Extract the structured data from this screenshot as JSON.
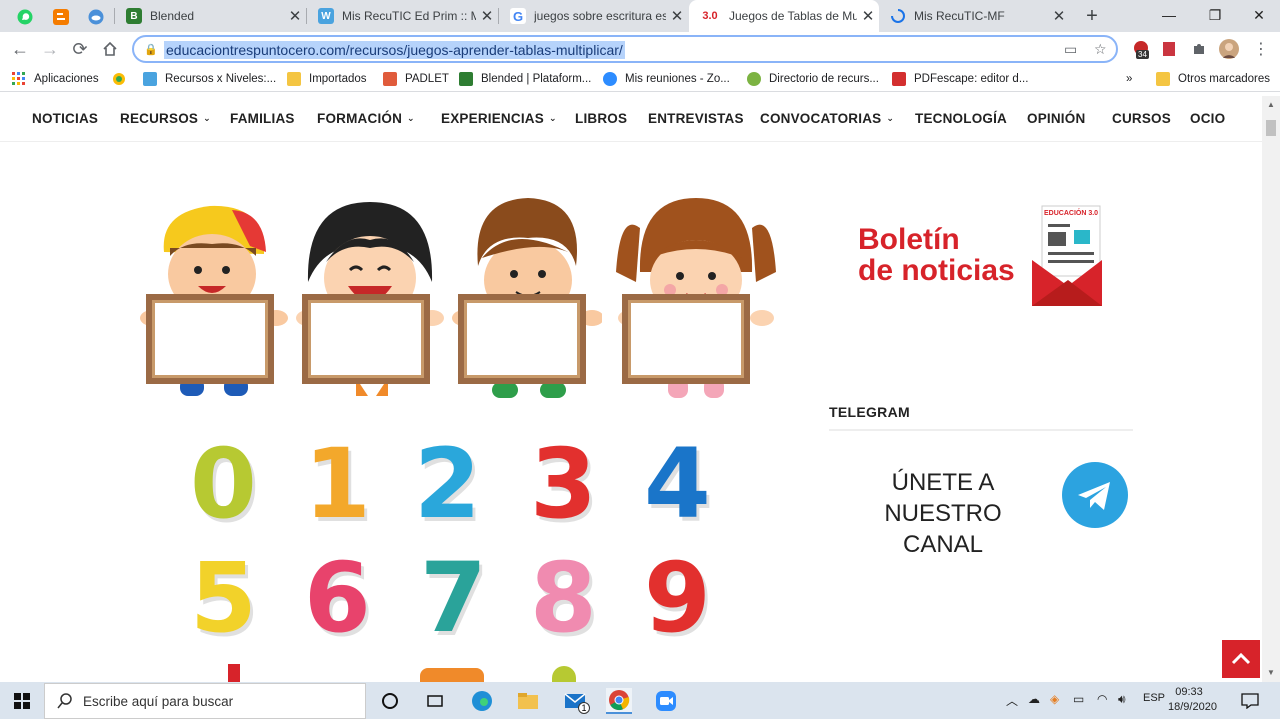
{
  "tabs": [
    {
      "title": "Blended",
      "fav_text": "B",
      "fav_color": "#2e7d32"
    },
    {
      "title": "Mis RecuTIC Ed Prim :: Mis",
      "fav_text": "W",
      "fav_color": "#4aa3df"
    },
    {
      "title": "juegos sobre escritura esp",
      "fav_text": "G",
      "fav_color": "#4285f4"
    },
    {
      "title": "Juegos de Tablas de Multip",
      "fav_text": "3.0",
      "fav_color": "#d7232a"
    },
    {
      "title": "Mis RecuTIC-MF",
      "fav_text": "",
      "fav_color": "#1a73e8"
    }
  ],
  "address": {
    "url": "educaciontrespuntocero.com/recursos/juegos-aprender-tablas-multiplicar/"
  },
  "extensions": {
    "badge": "34"
  },
  "bookmarks": [
    {
      "label": "Aplicaciones",
      "color": "#ea4335"
    },
    {
      "label": "",
      "color": "#fbbc05"
    },
    {
      "label": "Recursos x Niveles:...",
      "color": "#4aa3df"
    },
    {
      "label": "Importados",
      "color": "#f4c542"
    },
    {
      "label": "PADLET",
      "color": "#e05b3b"
    },
    {
      "label": "Blended | Plataform...",
      "color": "#2e7d32"
    },
    {
      "label": "Mis reuniones - Zo...",
      "color": "#2d8cff"
    },
    {
      "label": "Directorio de recurs...",
      "color": "#7cb342"
    },
    {
      "label": "PDFescape: editor d...",
      "color": "#d32f2f"
    },
    {
      "label": "»",
      "color": ""
    },
    {
      "label": "Otros marcadores",
      "color": "#f4c542"
    }
  ],
  "nav": {
    "items": [
      "NOTICIAS",
      "RECURSOS",
      "FAMILIAS",
      "FORMACIÓN",
      "EXPERIENCIAS",
      "LIBROS",
      "ENTREVISTAS",
      "CONVOCATORIAS",
      "TECNOLOGÍA",
      "OPINIÓN",
      "CURSOS",
      "OCIO"
    ],
    "chevron": "⌄"
  },
  "numbers": [
    "0",
    "1",
    "2",
    "3",
    "4",
    "5",
    "6",
    "7",
    "8",
    "9"
  ],
  "number_colors": [
    "#b7c932",
    "#f3a82b",
    "#2aa7db",
    "#e2302e",
    "#1a75c9",
    "#f2d22a",
    "#e8436c",
    "#2aa39a",
    "#f08bb0",
    "#e2302e"
  ],
  "sidebar": {
    "boletin_line1": "Boletín",
    "boletin_line2": "de noticias",
    "envelope_label": "EDUCACIÓN 3.0",
    "telegram_title": "TELEGRAM",
    "telegram_line1": "ÚNETE A NUESTRO",
    "telegram_line2": "CANAL"
  },
  "taskbar": {
    "search_placeholder": "Escribe aquí para buscar",
    "language": "ESP",
    "time": "09:33",
    "date": "18/9/2020",
    "mail_badge": "1"
  }
}
